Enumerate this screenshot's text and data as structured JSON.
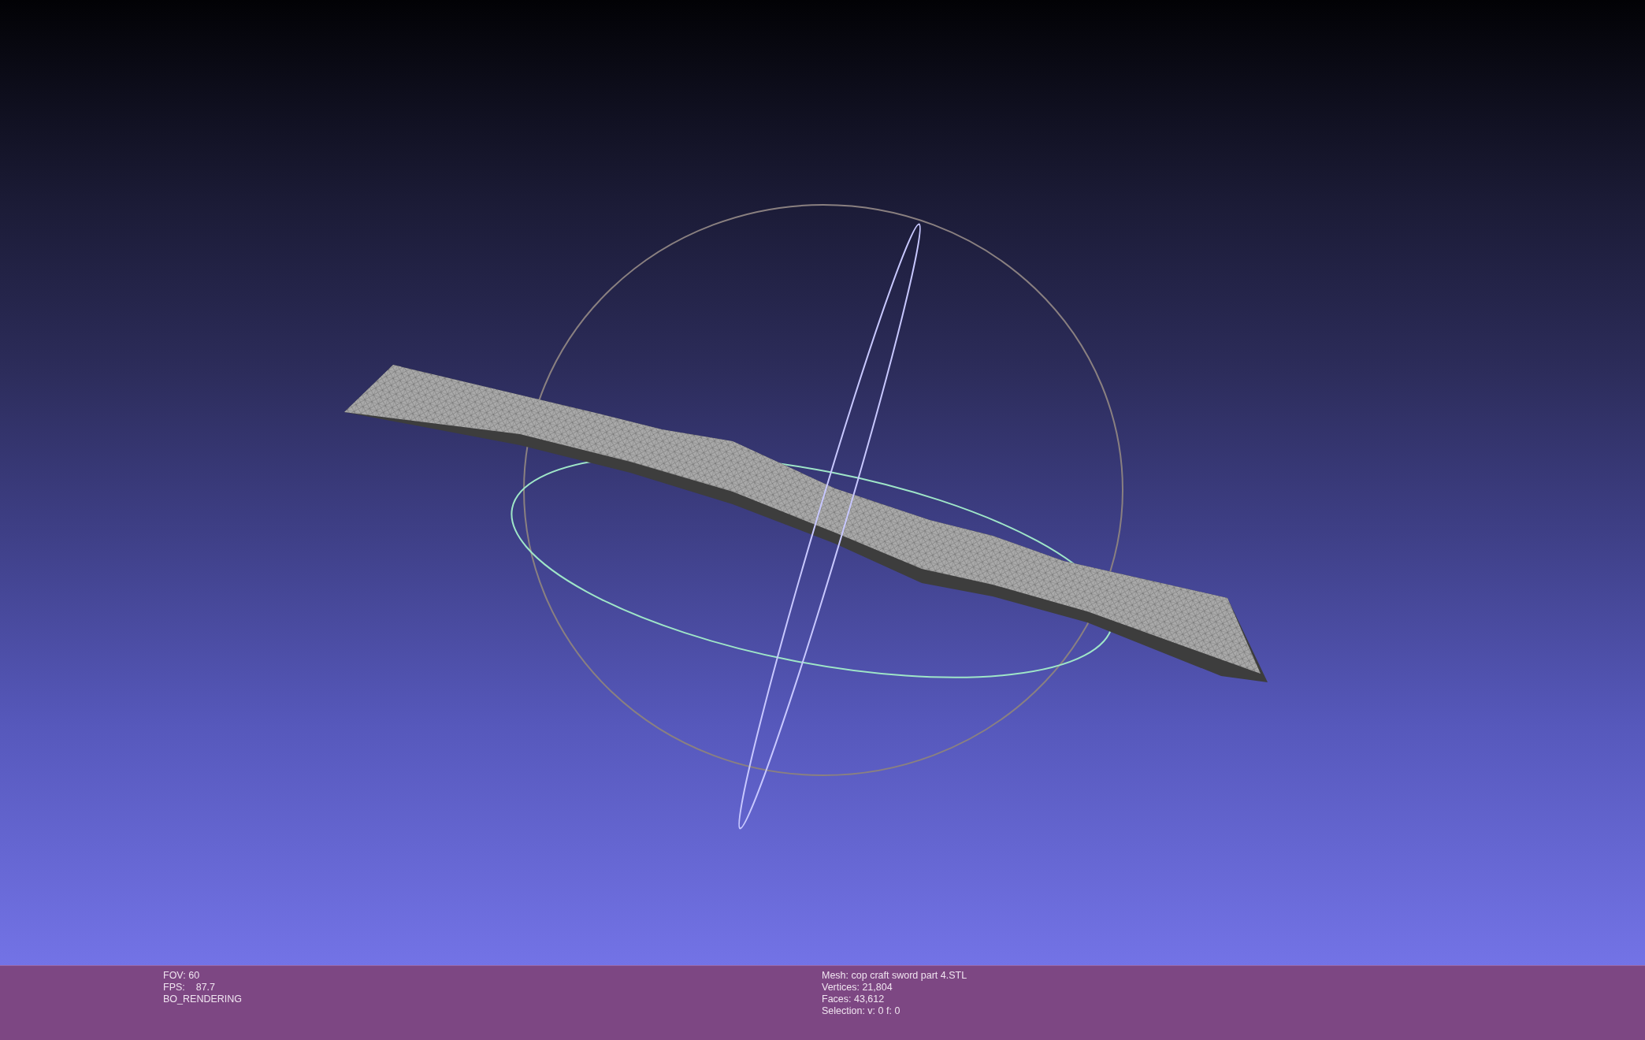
{
  "status_bar": {
    "left_lines": [
      "FOV: 60",
      "FPS:    87.7",
      "BO_RENDERING"
    ],
    "right_lines": [
      "Mesh: cop craft sword part 4.STL",
      "Vertices: 21,804",
      "Faces: 43,612",
      "Selection: v: 0 f: 0"
    ]
  }
}
